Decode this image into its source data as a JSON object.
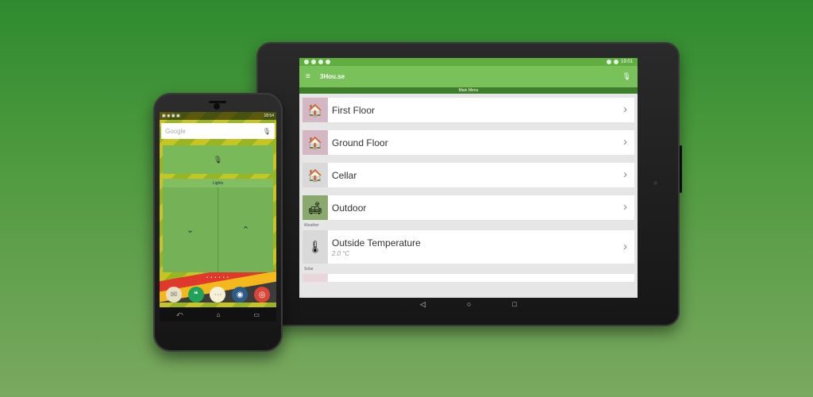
{
  "tablet": {
    "status_left_icons": [
      "notif-icon",
      "notif-icon",
      "notif-icon",
      "notif-icon"
    ],
    "status_time": "19:01",
    "app_title": "3Hou.se",
    "sub_title": "Main Menu",
    "rows": [
      {
        "label": "First Floor",
        "icon": "house-icon",
        "thumb_color": "#d3b7c4"
      },
      {
        "label": "Ground Floor",
        "icon": "house-icon",
        "thumb_color": "#d3b7c4"
      },
      {
        "label": "Cellar",
        "icon": "house-icon",
        "thumb_color": "#d9d9d9"
      }
    ],
    "outdoor": {
      "label": "Outdoor",
      "icon": "sofa-icon",
      "thumb_color": "#8aa96c"
    },
    "section_weather": "Weather",
    "temp": {
      "label": "Outside Temperature",
      "value": "2.0 °C",
      "icon": "thermometer-icon",
      "thumb_color": "#d9d9d9"
    },
    "section_other": "Solar",
    "nav": {
      "back": "◁",
      "home": "○",
      "recent": "□"
    }
  },
  "phone": {
    "status_time": "18:54",
    "search_placeholder": "Google",
    "lights_title": "Lights",
    "down_glyph": "⌄",
    "up_glyph": "⌃",
    "page_dots": "• • • • • •",
    "nav": {
      "back": "⤺",
      "home": "⌂",
      "recent": "▭"
    },
    "dock": [
      {
        "name": "app-icon-1",
        "color": "#e7e0c8",
        "glyph": "✉"
      },
      {
        "name": "hangouts-icon",
        "color": "#1fa35b",
        "glyph": "❝"
      },
      {
        "name": "apps-drawer-icon",
        "color": "#f5f0d8",
        "glyph": "⋯"
      },
      {
        "name": "camera-icon",
        "color": "#2b5c8a",
        "glyph": "◉"
      },
      {
        "name": "chrome-icon",
        "color": "#db4437",
        "glyph": "◎"
      }
    ]
  }
}
